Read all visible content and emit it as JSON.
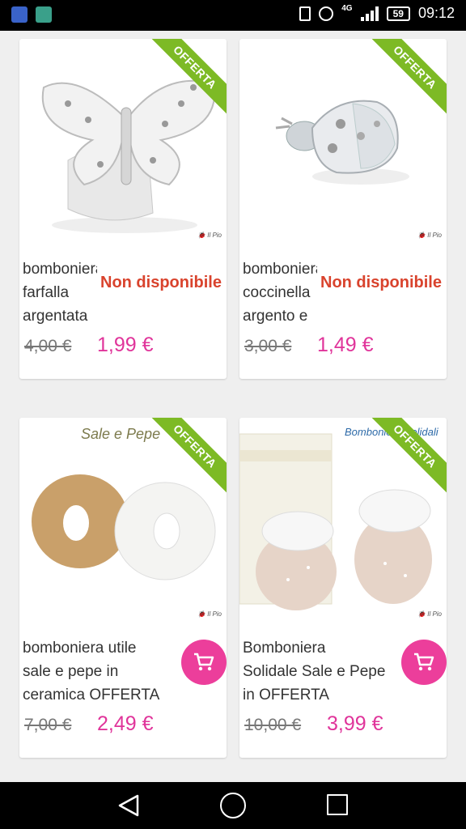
{
  "status_bar": {
    "network": "4G",
    "battery": "59",
    "time": "09:12"
  },
  "colors": {
    "ribbon": "#7dba25",
    "price": "#e0349a",
    "unavailable": "#d9432d",
    "cart_button": "#ec3e9b"
  },
  "products": [
    {
      "ribbon": "OFFERTA",
      "name": "bomboniera\nfarfalla\nargentata",
      "status": "Non disponibile",
      "old_price": "4,00 €",
      "price": "1,99 €",
      "image": "silver-butterfly-favor",
      "brand": "Il Pio"
    },
    {
      "ribbon": "OFFERTA",
      "name": "bomboniera\ncoccinella\nargento e",
      "status": "Non disponibile",
      "old_price": "3,00 €",
      "price": "1,49 €",
      "image": "silver-ladybug-favor",
      "brand": "Il Pio"
    },
    {
      "ribbon": "OFFERTA",
      "name": "bomboniera utile\nsale e pepe in\nceramica OFFERTA",
      "image_caption": "Sale e Pepe",
      "old_price": "7,00 €",
      "price": "2,49 €",
      "image": "ceramic-salt-pepper-rings",
      "brand": "Il Pio"
    },
    {
      "ribbon": "OFFERTA",
      "name": "Bomboniera\nSolidale Sale e Pepe\nin OFFERTA",
      "image_caption": "Bomboniere Solidali",
      "old_price": "10,00 €",
      "price": "3,99 €",
      "image": "ceramic-salt-pepper-jars",
      "brand": "Il Pio"
    }
  ],
  "nav": {
    "back_icon": "back-triangle-icon",
    "home_icon": "home-circle-icon",
    "recents_icon": "recents-square-icon"
  }
}
